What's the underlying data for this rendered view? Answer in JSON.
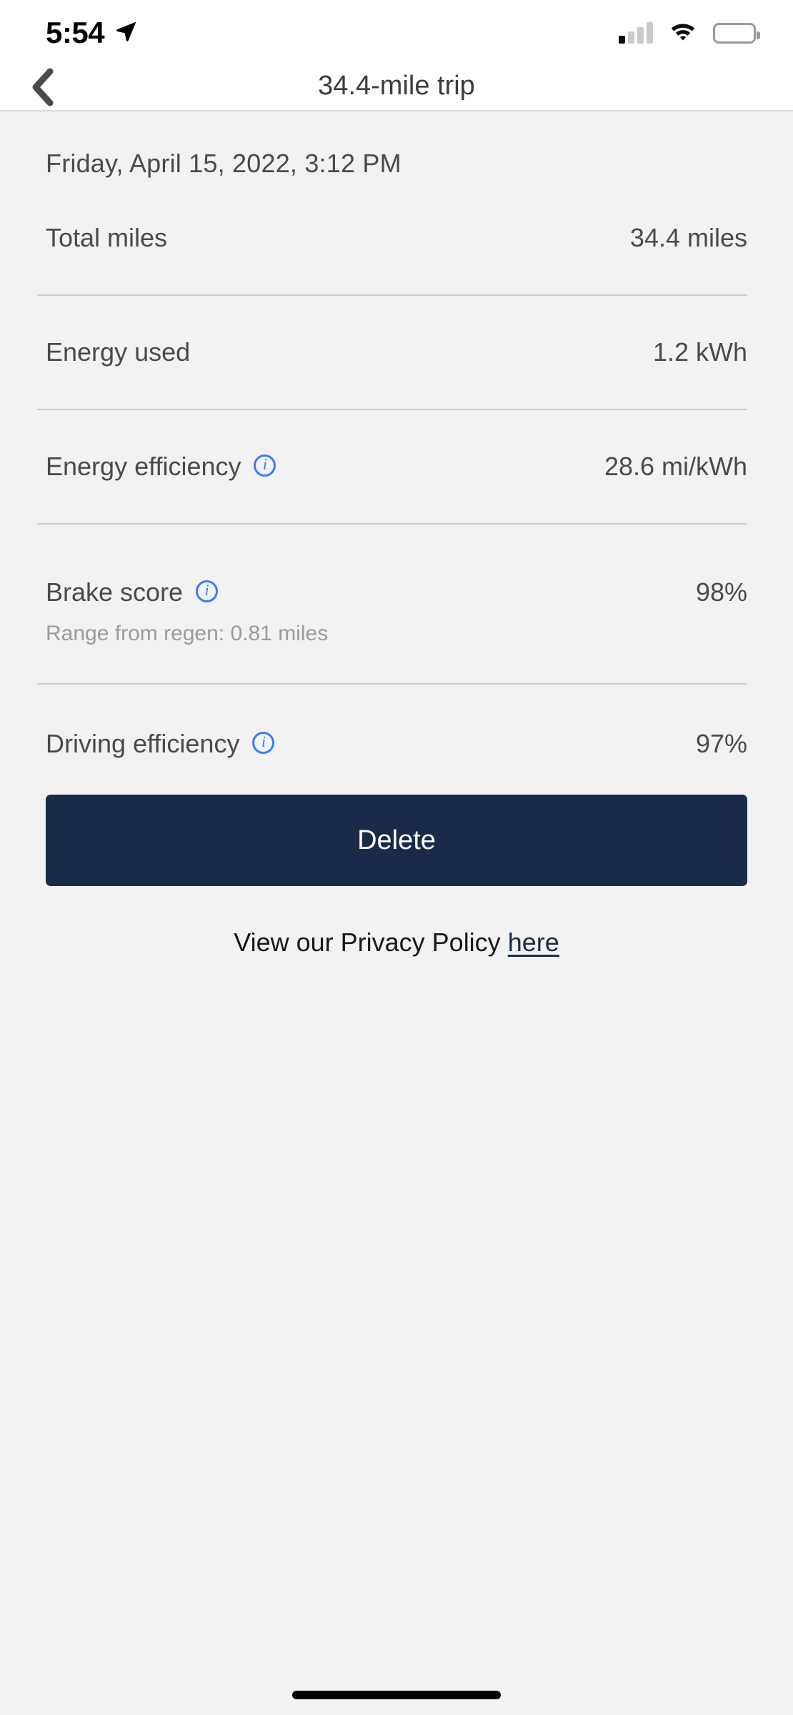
{
  "status_bar": {
    "time": "5:54",
    "location_icon": "location-arrow-icon",
    "signal_icon": "cellular-signal-icon",
    "signal_bars_active": 1,
    "wifi_icon": "wifi-icon",
    "battery_icon": "battery-icon",
    "battery_level_percent": 45
  },
  "header": {
    "back_icon": "chevron-left-icon",
    "title": "34.4-mile trip"
  },
  "trip": {
    "date": "Friday, April 15, 2022, 3:12 PM",
    "stats": [
      {
        "label": "Total miles",
        "value": "34.4 miles",
        "info": false,
        "sub": ""
      },
      {
        "label": "Energy used",
        "value": "1.2 kWh",
        "info": false,
        "sub": ""
      },
      {
        "label": "Energy efficiency",
        "value": "28.6 mi/kWh",
        "info": true,
        "info_icon": "info-circle-icon",
        "sub": ""
      },
      {
        "label": "Brake score",
        "value": "98%",
        "info": true,
        "info_icon": "info-circle-icon",
        "sub": "Range from regen: 0.81 miles"
      },
      {
        "label": "Driving efficiency",
        "value": "97%",
        "info": true,
        "info_icon": "info-circle-icon",
        "sub": ""
      }
    ]
  },
  "actions": {
    "delete_label": "Delete"
  },
  "footer": {
    "privacy_text": "View our Privacy Policy",
    "privacy_link_label": "here"
  },
  "colors": {
    "background": "#f2f2f2",
    "surface": "#ffffff",
    "primary_text": "#4a4a4a",
    "muted_text": "#9b9b9b",
    "accent_info": "#3d7cf4",
    "brand_navy": "#1a2b49",
    "divider": "#cdcdcd"
  }
}
